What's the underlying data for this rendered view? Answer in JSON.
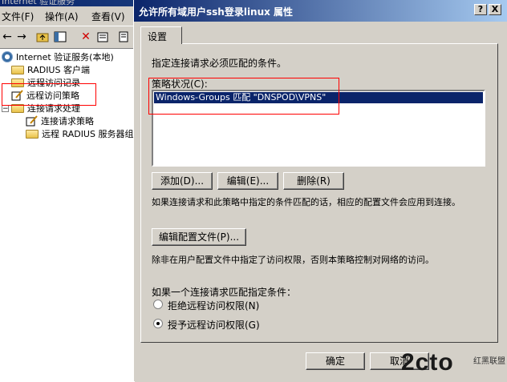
{
  "background_window": {
    "title": "Internet 验证服务",
    "menu": [
      "文件(F)",
      "操作(A)",
      "查看(V)"
    ],
    "toolbar_icons": [
      "back-arrow-icon",
      "forward-arrow-icon",
      "up-folder-icon",
      "show-tree-icon",
      "delete-icon",
      "properties-icon",
      "export-icon"
    ],
    "tree": [
      {
        "label": "Internet 验证服务(本地)",
        "icon": "ias-icon"
      },
      {
        "label": "RADIUS 客户端",
        "icon": "folder-icon"
      },
      {
        "label": "远程访问记录",
        "icon": "folder-icon"
      },
      {
        "label": "远程访问策略",
        "icon": "policy-icon"
      },
      {
        "label": "连接请求处理",
        "icon": "folder-icon"
      },
      {
        "label": "连接请求策略",
        "icon": "policy-icon"
      },
      {
        "label": "远程 RADIUS 服务器组",
        "icon": "folder-icon"
      }
    ]
  },
  "dialog": {
    "title": "允许所有域用户ssh登录linux 属性",
    "help_btn": "?",
    "close_btn": "X",
    "tab": "设置",
    "intro": "指定连接请求必须匹配的条件。",
    "conditions_label": "策略状况(C):",
    "conditions": [
      "Windows-Groups 匹配 \"DNSPOD\\VPNS\""
    ],
    "buttons": {
      "add": "添加(D)...",
      "edit": "编辑(E)...",
      "remove": "删除(R)"
    },
    "match_text": "如果连接请求和此策略中指定的条件匹配的话，相应的配置文件会应用到连接。",
    "edit_profile": "编辑配置文件(P)...",
    "profile_text": "除非在用户配置文件中指定了访问权限，否则本策略控制对网络的访问。",
    "match_question": "如果一个连接请求匹配指定条件：",
    "radio_deny": "拒绝远程访问权限(N)",
    "radio_grant": "授予远程访问权限(G)",
    "selected": "grant",
    "ok": "确定",
    "cancel": "取消"
  },
  "watermark": {
    "text": "2cto",
    "sub": "红黑联盟"
  }
}
